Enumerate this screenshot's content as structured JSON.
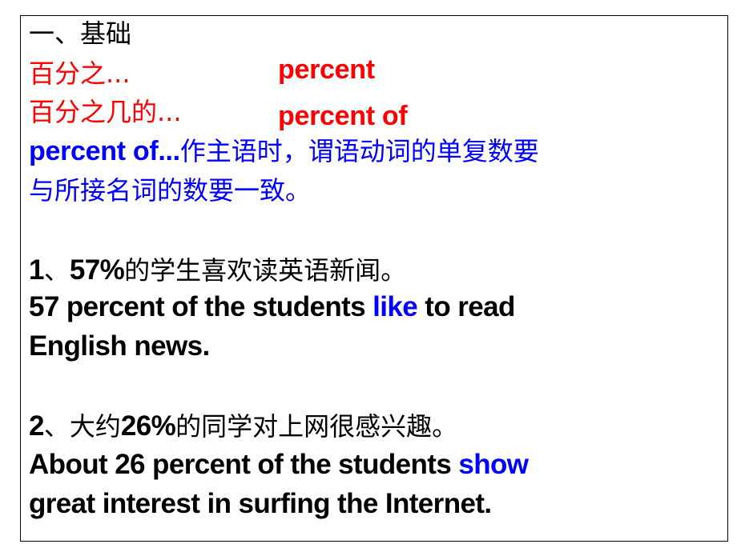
{
  "heading": "一、基础",
  "definitions": [
    {
      "cn": "百分之...",
      "en": "percent"
    },
    {
      "cn": "百分之几的...",
      "en": "percent of"
    }
  ],
  "rule": {
    "lead": "percent of...",
    "line1_rest": "作主语时，谓语动词的单复数要",
    "line2": "与所接名词的数要一致。"
  },
  "examples": [
    {
      "num": "1",
      "sep": "、",
      "cn_pre": "",
      "cn_pct": "57%",
      "cn_post": "的学生喜欢读英语新闻。",
      "en_pre": "57 percent of the students ",
      "en_verb": "like",
      "en_post": " to read",
      "en_line2": "English news."
    },
    {
      "num": "2",
      "sep": "、",
      "cn_pre": "大约",
      "cn_pct": "26%",
      "cn_post": "的同学对上网很感兴趣。",
      "en_pre": "About 26 percent of the students ",
      "en_verb": "show",
      "en_post": "",
      "en_line2": "great interest in surfing the Internet."
    }
  ],
  "colors": {
    "term": "#ff0000",
    "rule": "#0000ff",
    "verb": "#0000ff",
    "text": "#000000"
  }
}
